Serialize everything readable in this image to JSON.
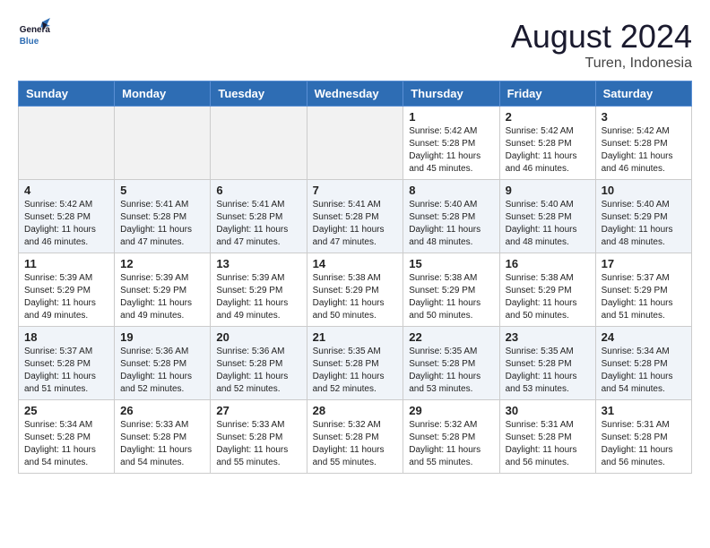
{
  "header": {
    "logo_general": "General",
    "logo_blue": "Blue",
    "month": "August 2024",
    "location": "Turen, Indonesia"
  },
  "weekdays": [
    "Sunday",
    "Monday",
    "Tuesday",
    "Wednesday",
    "Thursday",
    "Friday",
    "Saturday"
  ],
  "weeks": [
    [
      {
        "day": "",
        "info": ""
      },
      {
        "day": "",
        "info": ""
      },
      {
        "day": "",
        "info": ""
      },
      {
        "day": "",
        "info": ""
      },
      {
        "day": "1",
        "info": "Sunrise: 5:42 AM\nSunset: 5:28 PM\nDaylight: 11 hours\nand 45 minutes."
      },
      {
        "day": "2",
        "info": "Sunrise: 5:42 AM\nSunset: 5:28 PM\nDaylight: 11 hours\nand 46 minutes."
      },
      {
        "day": "3",
        "info": "Sunrise: 5:42 AM\nSunset: 5:28 PM\nDaylight: 11 hours\nand 46 minutes."
      }
    ],
    [
      {
        "day": "4",
        "info": "Sunrise: 5:42 AM\nSunset: 5:28 PM\nDaylight: 11 hours\nand 46 minutes."
      },
      {
        "day": "5",
        "info": "Sunrise: 5:41 AM\nSunset: 5:28 PM\nDaylight: 11 hours\nand 47 minutes."
      },
      {
        "day": "6",
        "info": "Sunrise: 5:41 AM\nSunset: 5:28 PM\nDaylight: 11 hours\nand 47 minutes."
      },
      {
        "day": "7",
        "info": "Sunrise: 5:41 AM\nSunset: 5:28 PM\nDaylight: 11 hours\nand 47 minutes."
      },
      {
        "day": "8",
        "info": "Sunrise: 5:40 AM\nSunset: 5:28 PM\nDaylight: 11 hours\nand 48 minutes."
      },
      {
        "day": "9",
        "info": "Sunrise: 5:40 AM\nSunset: 5:28 PM\nDaylight: 11 hours\nand 48 minutes."
      },
      {
        "day": "10",
        "info": "Sunrise: 5:40 AM\nSunset: 5:29 PM\nDaylight: 11 hours\nand 48 minutes."
      }
    ],
    [
      {
        "day": "11",
        "info": "Sunrise: 5:39 AM\nSunset: 5:29 PM\nDaylight: 11 hours\nand 49 minutes."
      },
      {
        "day": "12",
        "info": "Sunrise: 5:39 AM\nSunset: 5:29 PM\nDaylight: 11 hours\nand 49 minutes."
      },
      {
        "day": "13",
        "info": "Sunrise: 5:39 AM\nSunset: 5:29 PM\nDaylight: 11 hours\nand 49 minutes."
      },
      {
        "day": "14",
        "info": "Sunrise: 5:38 AM\nSunset: 5:29 PM\nDaylight: 11 hours\nand 50 minutes."
      },
      {
        "day": "15",
        "info": "Sunrise: 5:38 AM\nSunset: 5:29 PM\nDaylight: 11 hours\nand 50 minutes."
      },
      {
        "day": "16",
        "info": "Sunrise: 5:38 AM\nSunset: 5:29 PM\nDaylight: 11 hours\nand 50 minutes."
      },
      {
        "day": "17",
        "info": "Sunrise: 5:37 AM\nSunset: 5:29 PM\nDaylight: 11 hours\nand 51 minutes."
      }
    ],
    [
      {
        "day": "18",
        "info": "Sunrise: 5:37 AM\nSunset: 5:28 PM\nDaylight: 11 hours\nand 51 minutes."
      },
      {
        "day": "19",
        "info": "Sunrise: 5:36 AM\nSunset: 5:28 PM\nDaylight: 11 hours\nand 52 minutes."
      },
      {
        "day": "20",
        "info": "Sunrise: 5:36 AM\nSunset: 5:28 PM\nDaylight: 11 hours\nand 52 minutes."
      },
      {
        "day": "21",
        "info": "Sunrise: 5:35 AM\nSunset: 5:28 PM\nDaylight: 11 hours\nand 52 minutes."
      },
      {
        "day": "22",
        "info": "Sunrise: 5:35 AM\nSunset: 5:28 PM\nDaylight: 11 hours\nand 53 minutes."
      },
      {
        "day": "23",
        "info": "Sunrise: 5:35 AM\nSunset: 5:28 PM\nDaylight: 11 hours\nand 53 minutes."
      },
      {
        "day": "24",
        "info": "Sunrise: 5:34 AM\nSunset: 5:28 PM\nDaylight: 11 hours\nand 54 minutes."
      }
    ],
    [
      {
        "day": "25",
        "info": "Sunrise: 5:34 AM\nSunset: 5:28 PM\nDaylight: 11 hours\nand 54 minutes."
      },
      {
        "day": "26",
        "info": "Sunrise: 5:33 AM\nSunset: 5:28 PM\nDaylight: 11 hours\nand 54 minutes."
      },
      {
        "day": "27",
        "info": "Sunrise: 5:33 AM\nSunset: 5:28 PM\nDaylight: 11 hours\nand 55 minutes."
      },
      {
        "day": "28",
        "info": "Sunrise: 5:32 AM\nSunset: 5:28 PM\nDaylight: 11 hours\nand 55 minutes."
      },
      {
        "day": "29",
        "info": "Sunrise: 5:32 AM\nSunset: 5:28 PM\nDaylight: 11 hours\nand 55 minutes."
      },
      {
        "day": "30",
        "info": "Sunrise: 5:31 AM\nSunset: 5:28 PM\nDaylight: 11 hours\nand 56 minutes."
      },
      {
        "day": "31",
        "info": "Sunrise: 5:31 AM\nSunset: 5:28 PM\nDaylight: 11 hours\nand 56 minutes."
      }
    ]
  ]
}
